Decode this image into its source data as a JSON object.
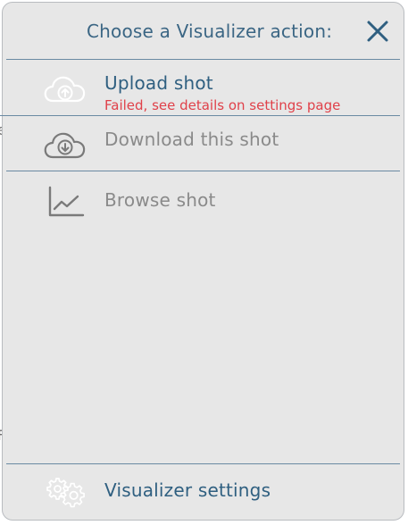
{
  "dialog": {
    "title": "Choose a Visualizer action:",
    "close_icon": "close-icon"
  },
  "actions": [
    {
      "label": "Upload shot",
      "sublabel": "Failed, see details on settings page",
      "icon": "cloud-upload-icon",
      "enabled": true
    },
    {
      "label": "Download this shot",
      "icon": "cloud-download-icon",
      "enabled": false
    },
    {
      "label": "Browse shot",
      "icon": "line-chart-icon",
      "enabled": false
    }
  ],
  "footer": {
    "label": "Visualizer settings",
    "icon": "gears-icon"
  },
  "colors": {
    "accent": "#2f5f80",
    "error": "#e0414a",
    "disabled": "#8a8a8a",
    "divider": "#6a8aa3",
    "panel": "#e7e7e7"
  }
}
